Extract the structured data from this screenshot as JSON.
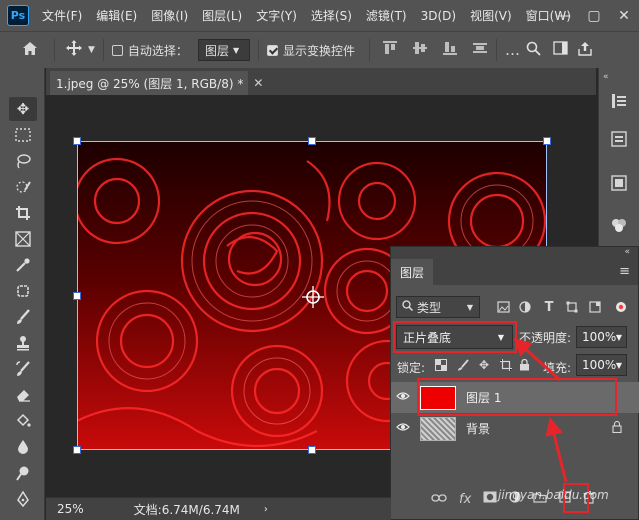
{
  "app": {
    "logo": "Ps",
    "menu": [
      "文件(F)",
      "编辑(E)",
      "图像(I)",
      "图层(L)",
      "文字(Y)",
      "选择(S)",
      "滤镜(T)",
      "3D(D)",
      "视图(V)",
      "窗口(W)"
    ],
    "window_buttons": [
      "—",
      "▢",
      "✕"
    ]
  },
  "options": {
    "home_icon": "home-icon",
    "move_icon": "move-icon",
    "auto_select_label": "自动选择：",
    "auto_select_checked": false,
    "target_select": "图层",
    "show_transform_label": "显示变换控件",
    "show_transform_checked": true
  },
  "document": {
    "tab_title": "1.jpeg @ 25% (图层 1, RGB/8) *",
    "zoom": "25%",
    "doc_size": "文档:6.74M/6.74M",
    "image_colors": {
      "dark": "#2b0000",
      "mid": "#9a0000",
      "bright": "#e81010"
    }
  },
  "layers_panel": {
    "tab_label": "图层",
    "kind_label": "类型",
    "blend_mode": "正片叠底",
    "opacity_label": "不透明度:",
    "opacity_value": "100%",
    "lock_label": "锁定:",
    "fill_label": "填充:",
    "fill_value": "100%",
    "layers": [
      {
        "name": "图层 1",
        "visible": true,
        "selected": true,
        "thumb_color": "#ee0000"
      },
      {
        "name": "背景",
        "visible": true,
        "selected": false,
        "locked": true
      }
    ]
  },
  "annotation": {
    "highlight_color": "#e5252a"
  },
  "watermark": "jingyan.baidu.com"
}
